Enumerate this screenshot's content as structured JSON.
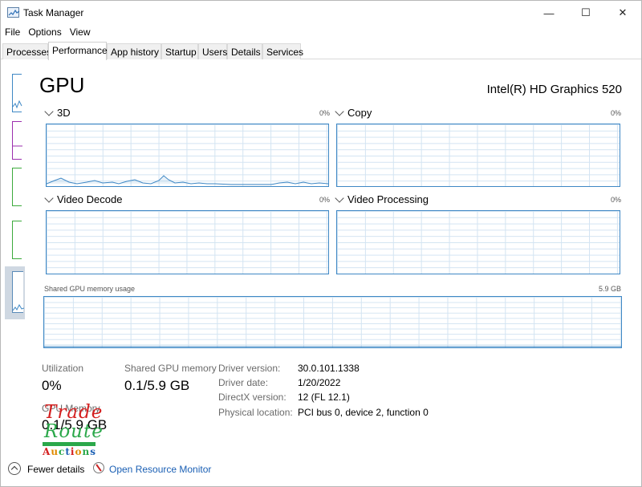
{
  "window": {
    "title": "Task Manager",
    "minimize_glyph": "—",
    "maximize_glyph": "☐",
    "close_glyph": "✕"
  },
  "menu": {
    "items": [
      "File",
      "Options",
      "View"
    ]
  },
  "tabs": [
    {
      "label": "Processes",
      "active": false
    },
    {
      "label": "Performance",
      "active": true
    },
    {
      "label": "App history",
      "active": false
    },
    {
      "label": "Startup",
      "active": false
    },
    {
      "label": "Users",
      "active": false
    },
    {
      "label": "Details",
      "active": false
    },
    {
      "label": "Services",
      "active": false
    }
  ],
  "main": {
    "title": "GPU",
    "model": "Intel(R) HD Graphics 520",
    "graphs": {
      "g3d": {
        "label": "3D",
        "percent": "0%"
      },
      "copy": {
        "label": "Copy",
        "percent": "0%"
      },
      "video_decode": {
        "label": "Video Decode",
        "percent": "0%"
      },
      "video_processing": {
        "label": "Video Processing",
        "percent": "0%"
      }
    },
    "shared_memory_graph": {
      "label": "Shared GPU memory usage",
      "value": "5.9 GB"
    }
  },
  "stats": {
    "utilization": {
      "label": "Utilization",
      "value": "0%"
    },
    "shared_gpu_memory": {
      "label": "Shared GPU memory",
      "value": "0.1/5.9 GB"
    },
    "gpu_memory": {
      "label": "GPU Memory",
      "value": "0.1/5.9 GB"
    }
  },
  "info": {
    "driver_version": {
      "label": "Driver version:",
      "value": "30.0.101.1338"
    },
    "driver_date": {
      "label": "Driver date:",
      "value": "1/20/2022"
    },
    "directx_version": {
      "label": "DirectX version:",
      "value": "12 (FL 12.1)"
    },
    "physical_location": {
      "label": "Physical location:",
      "value": "PCI bus 0, device 2, function 0"
    }
  },
  "watermark": {
    "line1": "Trade",
    "line2": "Route",
    "line3": "Auctions"
  },
  "footer": {
    "fewer_details": "Fewer details",
    "open_resource_monitor": "Open Resource Monitor"
  },
  "colors": {
    "graph_line": "#3f88c5",
    "grid": "#d3e4f2",
    "link": "#1a5fb4"
  },
  "sidebar_thumbs": [
    {
      "name": "cpu-thumb",
      "color": "#3f88c5"
    },
    {
      "name": "memory-thumb",
      "color": "#9b2fae"
    },
    {
      "name": "disk0-thumb",
      "color": "#3caa3c"
    },
    {
      "name": "disk1-thumb",
      "color": "#3caa3c"
    },
    {
      "name": "gpu-thumb",
      "color": "#3f88c5",
      "selected": true
    }
  ]
}
